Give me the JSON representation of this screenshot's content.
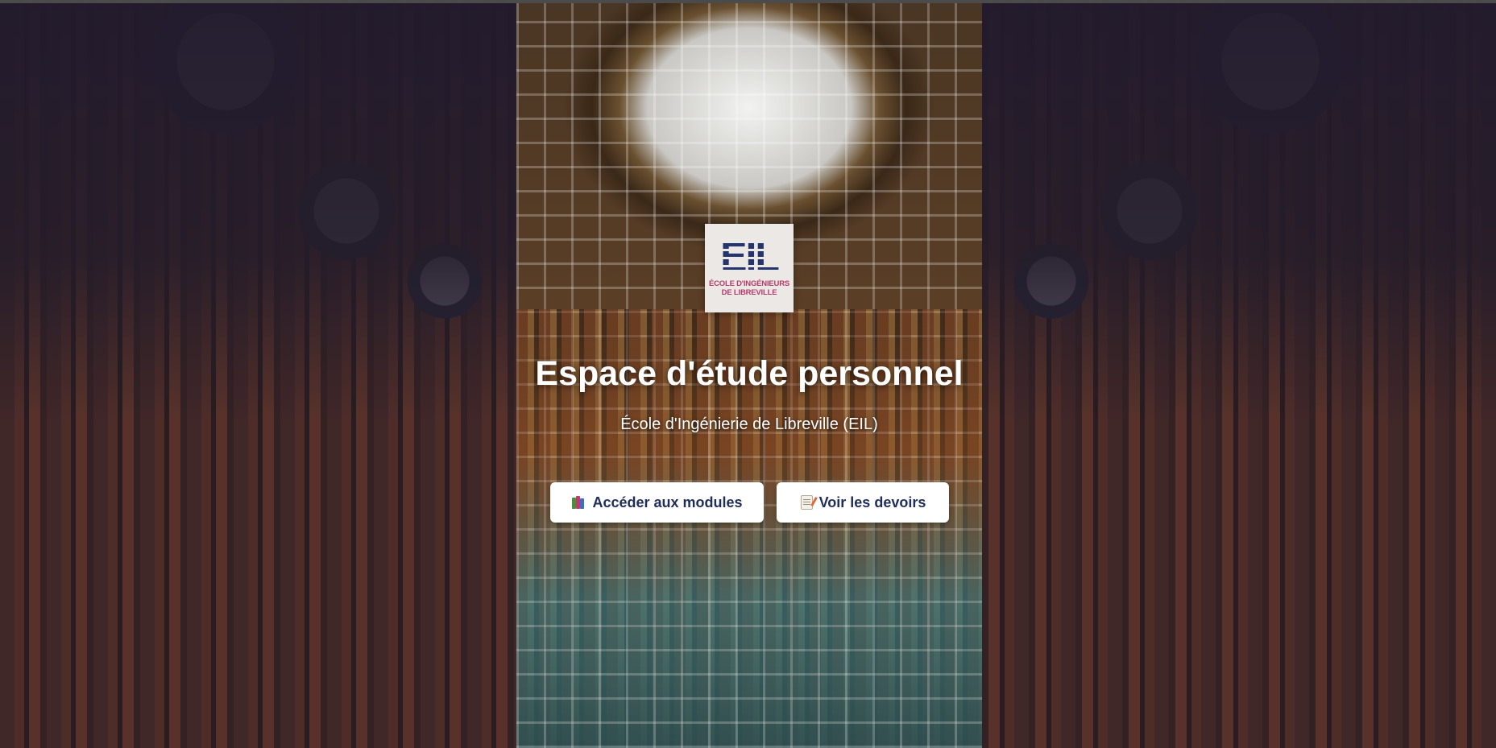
{
  "hero": {
    "logo": {
      "mark": "EIL",
      "line1": "École d'ingénieurs",
      "line2": "de Libreville"
    },
    "title": "Espace d'étude personnel",
    "subtitle": "École d'Ingénierie de Libreville (EIL)"
  },
  "actions": {
    "modules_label": "Accéder aux modules",
    "modules_icon": "books-icon",
    "devoirs_label": "Voir les devoirs",
    "devoirs_icon": "memo-icon"
  },
  "colors": {
    "button_text": "#1f2d5a",
    "logo_blue": "#24356e",
    "logo_magenta": "#b63a6a"
  }
}
